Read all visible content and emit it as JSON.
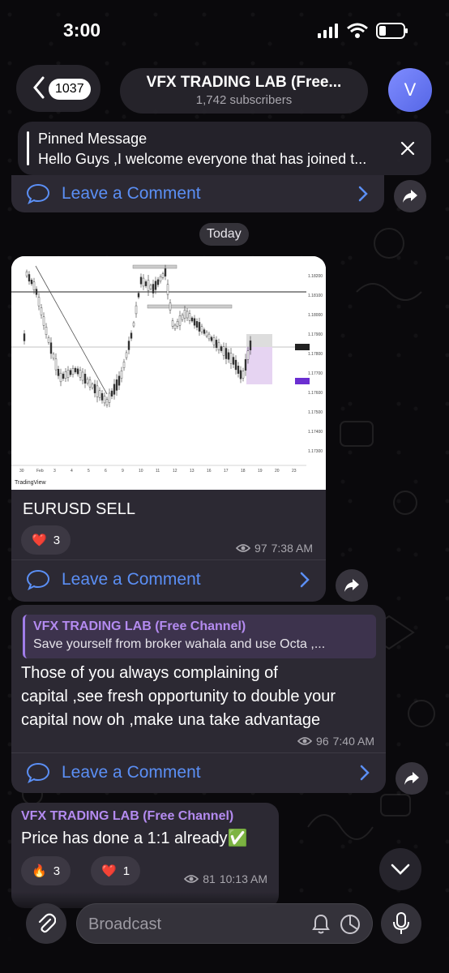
{
  "status_bar": {
    "time": "3:00"
  },
  "header": {
    "back_count": "1037",
    "title": "VFX TRADING LAB (Free...",
    "subscribers": "1,742 subscribers",
    "avatar_letter": "V"
  },
  "pinned": {
    "title": "Pinned Message",
    "text": "Hello Guys ,I welcome everyone that has joined t..."
  },
  "comment_label": "Leave a Comment",
  "date_separator": "Today",
  "messages": [
    {
      "text": "EURUSD SELL",
      "reactions": [
        {
          "emoji": "❤️",
          "count": "3"
        }
      ],
      "views": "97",
      "time": "7:38 AM",
      "image_caption": "TradingView",
      "image_axis": [
        "1.18200",
        "1.18100",
        "1.18000",
        "1.17900",
        "1.17800",
        "1.17700",
        "1.17600",
        "1.17500",
        "1.17400",
        "1.17300"
      ],
      "image_dates": [
        "30",
        "Feb",
        "3",
        "4",
        "5",
        "6",
        "9",
        "10",
        "11",
        "12",
        "13",
        "16",
        "17",
        "18",
        "19",
        "20",
        "23"
      ]
    },
    {
      "reply_title": "VFX TRADING LAB (Free Channel)",
      "reply_text": "Save yourself from broker wahala and use Octa ,...",
      "text_lines": [
        "Those of you always complaining of",
        "capital ,see fresh opportunity to double your",
        "capital now oh ,make una take advantage"
      ],
      "views": "96",
      "time": "7:40 AM"
    },
    {
      "channel": "VFX TRADING LAB (Free Channel)",
      "text": "Price has done a 1:1 already✅",
      "reactions": [
        {
          "emoji": "🔥",
          "count": "3"
        },
        {
          "emoji": "❤️",
          "count": "1"
        }
      ],
      "views": "81",
      "time": "10:13 AM"
    }
  ],
  "input": {
    "placeholder": "Broadcast"
  },
  "colors": {
    "accent": "#5b8ff5",
    "channel_purple": "#b48bf0",
    "bubble": "#2c2933"
  }
}
